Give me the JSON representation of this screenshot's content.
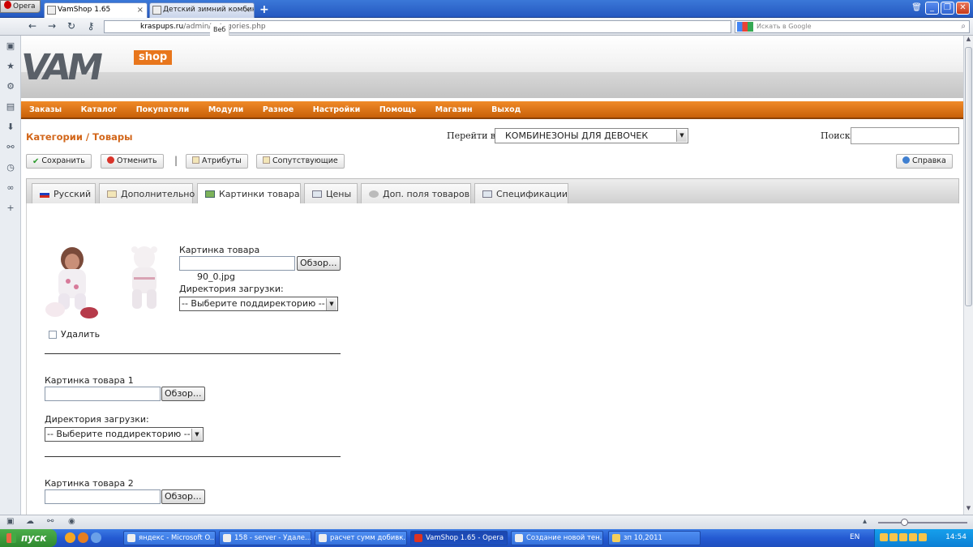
{
  "browser": {
    "menu_label": "Opera",
    "tabs": [
      {
        "title": "VamShop 1.65",
        "active": true
      },
      {
        "title": "Детский зимний комбин...",
        "active": false
      }
    ],
    "web_badge": "Веб",
    "url_host": "kraspups.ru",
    "url_path": "/admin/categories.php",
    "search_placeholder": "Искать в Google"
  },
  "header": {
    "logo_text": "VAM",
    "logo_badge": "shop"
  },
  "menu": [
    "Заказы",
    "Каталог",
    "Покупатели",
    "Модули",
    "Разное",
    "Настройки",
    "Помощь",
    "Магазин",
    "Выход"
  ],
  "page": {
    "breadcrumb": "Категории / Товары",
    "goto_label": "Перейти в:",
    "goto_value": "КОМБИНЕЗОНЫ ДЛЯ ДЕВОЧЕК",
    "search_label": "Поиск:"
  },
  "buttons": {
    "save": "Сохранить",
    "cancel": "Отменить",
    "separator": "|",
    "attributes": "Атрибуты",
    "related": "Сопутствующие",
    "help": "Справка"
  },
  "tabs": [
    "Русский",
    "Дополнительно",
    "Картинки товара",
    "Цены",
    "Доп. поля товаров",
    "Спецификации"
  ],
  "active_tab": "Картинки товара",
  "images": {
    "main_label": "Картинка товара",
    "browse_label": "Обзор...",
    "current_file": "90_0.jpg",
    "dir_label": "Директория загрузки:",
    "dir_placeholder": "-- Выберите поддиректорию --",
    "delete_label": "Удалить",
    "image1_label": "Картинка товара 1",
    "image2_label": "Картинка товара 2"
  },
  "taskbar": {
    "start": "пуск",
    "items": [
      "яндекс - Microsoft O...",
      "158 - server - Удале...",
      "расчет сумм добивк...",
      "VamShop 1.65 - Opera",
      "Создание новой тен...",
      "зп 10,2011"
    ],
    "lang": "EN",
    "clock": "14:54"
  },
  "colors": {
    "accent_orange": "#e8761c",
    "menu_orange": "#d86c10",
    "breadcrumb": "#d2661a",
    "taskbar_blue": "#245ad2"
  }
}
